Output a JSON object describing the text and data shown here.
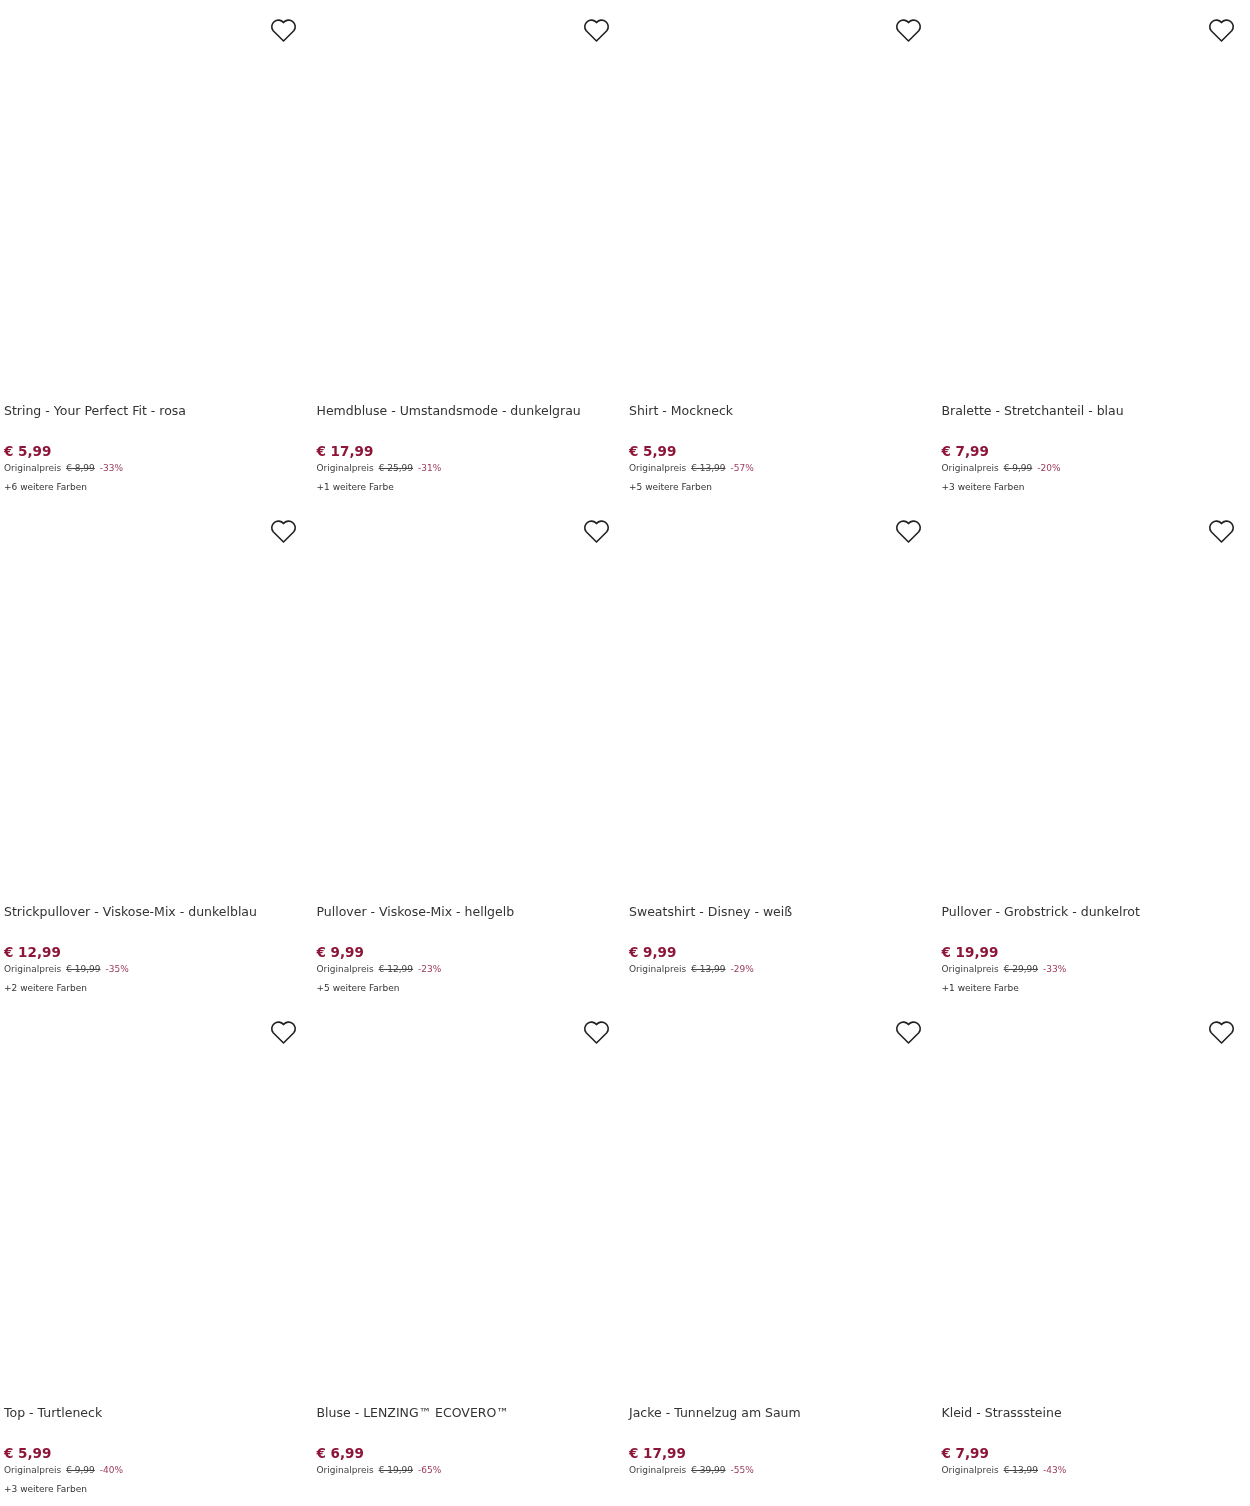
{
  "products": [
    {
      "title": "String - Your Perfect Fit - rosa",
      "price": "€ 5,99",
      "original_label": "Originalpreis",
      "original_price": "€ 8,99",
      "discount": "-33%",
      "more_colors": "+6 weitere Farben"
    },
    {
      "title": "Hemdbluse - Umstandsmode - dunkelgrau",
      "price": "€ 17,99",
      "original_label": "Originalpreis",
      "original_price": "€ 25,99",
      "discount": "-31%",
      "more_colors": "+1 weitere Farbe"
    },
    {
      "title": "Shirt - Mockneck",
      "price": "€ 5,99",
      "original_label": "Originalpreis",
      "original_price": "€ 13,99",
      "discount": "-57%",
      "more_colors": "+5 weitere Farben"
    },
    {
      "title": "Bralette - Stretchanteil - blau",
      "price": "€ 7,99",
      "original_label": "Originalpreis",
      "original_price": "€ 9,99",
      "discount": "-20%",
      "more_colors": "+3 weitere Farben"
    },
    {
      "title": "Strickpullover - Viskose-Mix - dunkelblau",
      "price": "€ 12,99",
      "original_label": "Originalpreis",
      "original_price": "€ 19,99",
      "discount": "-35%",
      "more_colors": "+2 weitere Farben"
    },
    {
      "title": "Pullover - Viskose-Mix - hellgelb",
      "price": "€ 9,99",
      "original_label": "Originalpreis",
      "original_price": "€ 12,99",
      "discount": "-23%",
      "more_colors": "+5 weitere Farben"
    },
    {
      "title": "Sweatshirt - Disney - weiß",
      "price": "€ 9,99",
      "original_label": "Originalpreis",
      "original_price": "€ 13,99",
      "discount": "-29%"
    },
    {
      "title": "Pullover - Grobstrick - dunkelrot",
      "price": "€ 19,99",
      "original_label": "Originalpreis",
      "original_price": "€ 29,99",
      "discount": "-33%",
      "more_colors": "+1 weitere Farbe"
    },
    {
      "title": "Top - Turtleneck",
      "price": "€ 5,99",
      "original_label": "Originalpreis",
      "original_price": "€ 9,99",
      "discount": "-40%",
      "more_colors": "+3 weitere Farben"
    },
    {
      "title": "Bluse - LENZING™ ECOVERO™",
      "price": "€ 6,99",
      "original_label": "Originalpreis",
      "original_price": "€ 19,99",
      "discount": "-65%"
    },
    {
      "title": "Jacke - Tunnelzug am Saum",
      "price": "€ 17,99",
      "original_label": "Originalpreis",
      "original_price": "€ 39,99",
      "discount": "-55%"
    },
    {
      "title": "Kleid - Strasssteine",
      "price": "€ 7,99",
      "original_label": "Originalpreis",
      "original_price": "€ 13,99",
      "discount": "-43%"
    }
  ]
}
